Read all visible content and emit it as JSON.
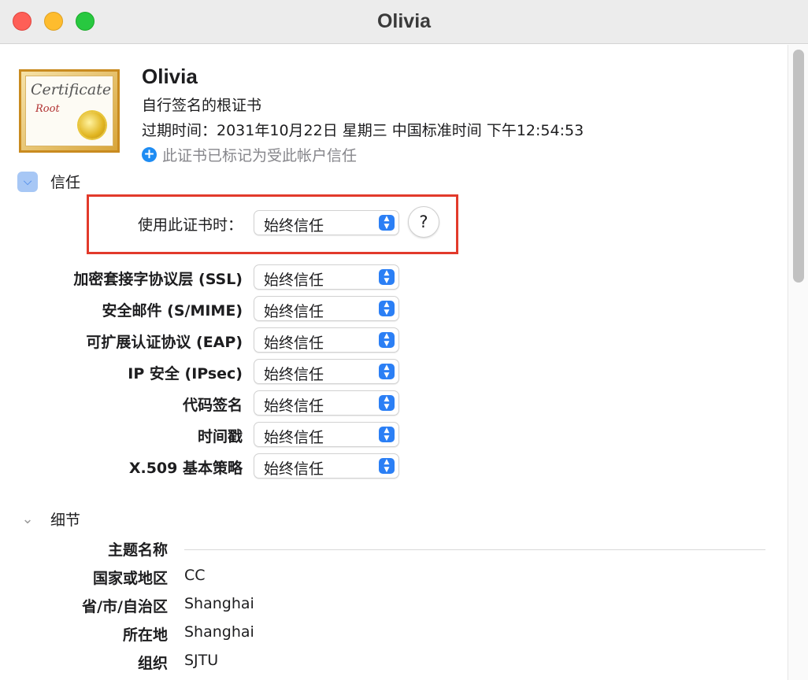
{
  "window": {
    "title": "Olivia"
  },
  "certificate": {
    "image_text": "Certificate",
    "image_subtext": "Root",
    "name": "Olivia",
    "type": "自行签名的根证书",
    "expiry": "过期时间：2031年10月22日 星期三 中国标准时间 下午12:54:53",
    "trust_note": "此证书已标记为受此帐户信任"
  },
  "trust": {
    "section_title": "信任",
    "main": {
      "label": "使用此证书时：",
      "value": "始终信任"
    },
    "help_label": "?",
    "policies": [
      {
        "label": "加密套接字协议层 (SSL)",
        "value": "始终信任"
      },
      {
        "label": "安全邮件 (S/MIME)",
        "value": "始终信任"
      },
      {
        "label": "可扩展认证协议 (EAP)",
        "value": "始终信任"
      },
      {
        "label": "IP 安全 (IPsec)",
        "value": "始终信任"
      },
      {
        "label": "代码签名",
        "value": "始终信任"
      },
      {
        "label": "时间戳",
        "value": "始终信任"
      },
      {
        "label": "X.509 基本策略",
        "value": "始终信任"
      }
    ]
  },
  "details": {
    "section_title": "细节",
    "subject_header": "主题名称",
    "rows": [
      {
        "key": "国家或地区",
        "value": "CC"
      },
      {
        "key": "省/市/自治区",
        "value": "Shanghai"
      },
      {
        "key": "所在地",
        "value": "Shanghai"
      },
      {
        "key": "组织",
        "value": "SJTU"
      }
    ]
  },
  "colors": {
    "highlight": "#e23a2b",
    "accent": "#2b7ff5"
  },
  "icons": {
    "trust_chevron": "chevron-down-icon",
    "details_chevron": "chevron-down-icon",
    "trust_note": "plus-circle-icon"
  }
}
